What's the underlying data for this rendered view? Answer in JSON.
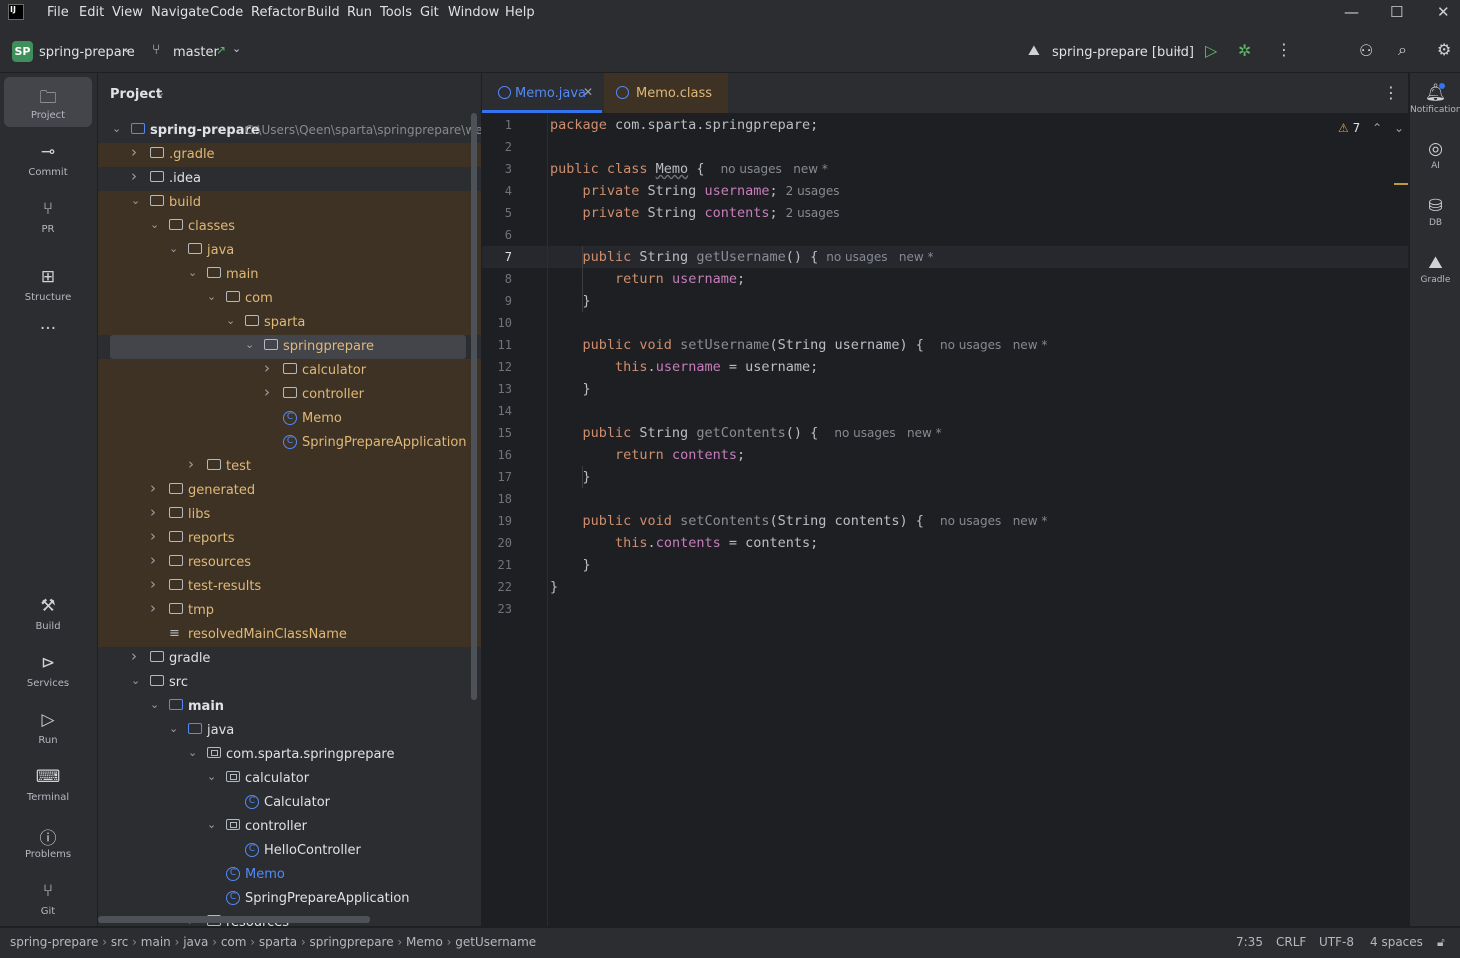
{
  "menu": {
    "items": [
      "File",
      "Edit",
      "View",
      "Navigate",
      "Code",
      "Refactor",
      "Build",
      "Run",
      "Tools",
      "Git",
      "Window",
      "Help"
    ]
  },
  "toolbar": {
    "project_badge": "SP",
    "project_name": "spring-prepare",
    "branch": "master",
    "run_config": "spring-prepare [build]"
  },
  "left_stripe": {
    "top": [
      {
        "label": "Project",
        "icon": "folder-icon"
      },
      {
        "label": "Commit",
        "icon": "commit-icon"
      },
      {
        "label": "PR",
        "icon": "pull-request-icon"
      },
      {
        "label": "Structure",
        "icon": "structure-icon"
      }
    ],
    "bottom": [
      {
        "label": "Build",
        "icon": "hammer-icon"
      },
      {
        "label": "Services",
        "icon": "services-icon"
      },
      {
        "label": "Run",
        "icon": "run-icon"
      },
      {
        "label": "Terminal",
        "icon": "terminal-icon"
      },
      {
        "label": "Problems",
        "icon": "problems-icon"
      },
      {
        "label": "Git",
        "icon": "git-icon"
      }
    ]
  },
  "project_panel": {
    "title": "Project",
    "tree": [
      {
        "label": "spring-prepare",
        "path": "C:\\Users\\Qeen\\sparta\\springprepare\\wee",
        "type": "module",
        "depth": 0,
        "expanded": true
      },
      {
        "label": ".gradle",
        "type": "folder",
        "depth": 1,
        "expanded": false,
        "excluded": true
      },
      {
        "label": ".idea",
        "type": "folder",
        "depth": 1,
        "expanded": false
      },
      {
        "label": "build",
        "type": "folder",
        "depth": 1,
        "expanded": true,
        "excluded": true
      },
      {
        "label": "classes",
        "type": "folder",
        "depth": 2,
        "expanded": true,
        "excluded": true
      },
      {
        "label": "java",
        "type": "folder",
        "depth": 3,
        "expanded": true,
        "excluded": true
      },
      {
        "label": "main",
        "type": "folder",
        "depth": 4,
        "expanded": true,
        "excluded": true
      },
      {
        "label": "com",
        "type": "folder",
        "depth": 5,
        "expanded": true,
        "excluded": true
      },
      {
        "label": "sparta",
        "type": "folder",
        "depth": 6,
        "expanded": true,
        "excluded": true
      },
      {
        "label": "springprepare",
        "type": "folder",
        "depth": 7,
        "expanded": true,
        "excluded": true,
        "selected": true
      },
      {
        "label": "calculator",
        "type": "folder",
        "depth": 8,
        "expanded": false,
        "excluded": true
      },
      {
        "label": "controller",
        "type": "folder",
        "depth": 8,
        "expanded": false,
        "excluded": true
      },
      {
        "label": "Memo",
        "type": "class",
        "depth": 8,
        "excluded": true
      },
      {
        "label": "SpringPrepareApplication",
        "type": "class",
        "depth": 8,
        "excluded": true
      },
      {
        "label": "test",
        "type": "folder",
        "depth": 4,
        "expanded": false,
        "excluded": true
      },
      {
        "label": "generated",
        "type": "folder",
        "depth": 2,
        "expanded": false,
        "excluded": true
      },
      {
        "label": "libs",
        "type": "folder",
        "depth": 2,
        "expanded": false,
        "excluded": true
      },
      {
        "label": "reports",
        "type": "folder",
        "depth": 2,
        "expanded": false,
        "excluded": true
      },
      {
        "label": "resources",
        "type": "folder",
        "depth": 2,
        "expanded": false,
        "excluded": true
      },
      {
        "label": "test-results",
        "type": "folder",
        "depth": 2,
        "expanded": false,
        "excluded": true
      },
      {
        "label": "tmp",
        "type": "folder",
        "depth": 2,
        "expanded": false,
        "excluded": true
      },
      {
        "label": "resolvedMainClassName",
        "type": "file",
        "depth": 2,
        "excluded": true
      },
      {
        "label": "gradle",
        "type": "folder",
        "depth": 1,
        "expanded": false
      },
      {
        "label": "src",
        "type": "folder",
        "depth": 1,
        "expanded": true
      },
      {
        "label": "main",
        "type": "srcfolder",
        "depth": 2,
        "expanded": true,
        "bold": true
      },
      {
        "label": "java",
        "type": "srcfolder",
        "depth": 3,
        "expanded": true
      },
      {
        "label": "com.sparta.springprepare",
        "type": "package",
        "depth": 4,
        "expanded": true
      },
      {
        "label": "calculator",
        "type": "package",
        "depth": 5,
        "expanded": true
      },
      {
        "label": "Calculator",
        "type": "class",
        "depth": 6
      },
      {
        "label": "controller",
        "type": "package",
        "depth": 5,
        "expanded": true
      },
      {
        "label": "HelloController",
        "type": "class",
        "depth": 6
      },
      {
        "label": "Memo",
        "type": "class",
        "depth": 5,
        "modified": true
      },
      {
        "label": "SpringPrepareApplication",
        "type": "class",
        "depth": 5
      },
      {
        "label": "resources",
        "type": "folder",
        "depth": 4,
        "expanded": false
      }
    ]
  },
  "editor": {
    "tabs": [
      {
        "label": "Memo.java",
        "active": true,
        "closable": true
      },
      {
        "label": "Memo.class",
        "active": false
      }
    ],
    "warnings_count": "7",
    "current_line": 7,
    "lines": [
      {
        "n": "1",
        "tokens": [
          [
            "kw",
            "package "
          ],
          [
            "txt",
            "com.sparta.springprepare;"
          ]
        ]
      },
      {
        "n": "2",
        "tokens": []
      },
      {
        "n": "3",
        "tokens": [
          [
            "kw",
            "public class "
          ],
          [
            "cls",
            "Memo"
          ],
          [
            "txt",
            " { "
          ]
        ],
        "hint": "no usages   new *"
      },
      {
        "n": "4",
        "tokens": [
          [
            "txt",
            "    "
          ],
          [
            "kw",
            "private "
          ],
          [
            "txt",
            "String "
          ],
          [
            "fld",
            "username"
          ],
          [
            "txt",
            ";"
          ]
        ],
        "hint": "2 usages"
      },
      {
        "n": "5",
        "tokens": [
          [
            "txt",
            "    "
          ],
          [
            "kw",
            "private "
          ],
          [
            "txt",
            "String "
          ],
          [
            "fld",
            "contents"
          ],
          [
            "txt",
            ";"
          ]
        ],
        "hint": "2 usages"
      },
      {
        "n": "6",
        "tokens": []
      },
      {
        "n": "7",
        "tokens": [
          [
            "txt",
            "    "
          ],
          [
            "kw",
            "public "
          ],
          [
            "txt",
            "String "
          ],
          [
            "mthd",
            "getUsername"
          ],
          [
            "txt",
            "() {"
          ]
        ],
        "hint": "no usages   new *"
      },
      {
        "n": "8",
        "tokens": [
          [
            "txt",
            "        "
          ],
          [
            "kw",
            "return "
          ],
          [
            "fld",
            "username"
          ],
          [
            "txt",
            ";"
          ]
        ]
      },
      {
        "n": "9",
        "tokens": [
          [
            "txt",
            "    }"
          ]
        ]
      },
      {
        "n": "10",
        "tokens": []
      },
      {
        "n": "11",
        "tokens": [
          [
            "txt",
            "    "
          ],
          [
            "kw",
            "public void "
          ],
          [
            "mthd",
            "setUsername"
          ],
          [
            "txt",
            "(String username) { "
          ]
        ],
        "hint": "no usages   new *"
      },
      {
        "n": "12",
        "tokens": [
          [
            "txt",
            "        "
          ],
          [
            "kw",
            "this"
          ],
          [
            "txt",
            "."
          ],
          [
            "fld",
            "username"
          ],
          [
            "txt",
            " = username;"
          ]
        ]
      },
      {
        "n": "13",
        "tokens": [
          [
            "txt",
            "    }"
          ]
        ]
      },
      {
        "n": "14",
        "tokens": []
      },
      {
        "n": "15",
        "tokens": [
          [
            "txt",
            "    "
          ],
          [
            "kw",
            "public "
          ],
          [
            "txt",
            "String "
          ],
          [
            "mthd",
            "getContents"
          ],
          [
            "txt",
            "() { "
          ]
        ],
        "hint": "no usages   new *"
      },
      {
        "n": "16",
        "tokens": [
          [
            "txt",
            "        "
          ],
          [
            "kw",
            "return "
          ],
          [
            "fld",
            "contents"
          ],
          [
            "txt",
            ";"
          ]
        ]
      },
      {
        "n": "17",
        "tokens": [
          [
            "txt",
            "    }"
          ]
        ]
      },
      {
        "n": "18",
        "tokens": []
      },
      {
        "n": "19",
        "tokens": [
          [
            "txt",
            "    "
          ],
          [
            "kw",
            "public void "
          ],
          [
            "mthd",
            "setContents"
          ],
          [
            "txt",
            "(String contents) { "
          ]
        ],
        "hint": "no usages   new *"
      },
      {
        "n": "20",
        "tokens": [
          [
            "txt",
            "        "
          ],
          [
            "kw",
            "this"
          ],
          [
            "txt",
            "."
          ],
          [
            "fld",
            "contents"
          ],
          [
            "txt",
            " = contents;"
          ]
        ]
      },
      {
        "n": "21",
        "tokens": [
          [
            "txt",
            "    }"
          ]
        ]
      },
      {
        "n": "22",
        "tokens": [
          [
            "txt",
            "}"
          ]
        ]
      },
      {
        "n": "23",
        "tokens": []
      }
    ]
  },
  "right_stripe": [
    {
      "label": "Notifications",
      "icon": "bell-icon"
    },
    {
      "label": "AI",
      "icon": "ai-icon"
    },
    {
      "label": "DB",
      "icon": "database-icon"
    },
    {
      "label": "Gradle",
      "icon": "gradle-icon"
    }
  ],
  "statusbar": {
    "breadcrumbs": [
      "spring-prepare",
      "src",
      "main",
      "java",
      "com",
      "sparta",
      "springprepare",
      "Memo",
      "getUsername"
    ],
    "position": "7:35",
    "line_sep": "CRLF",
    "encoding": "UTF-8",
    "indent": "4 spaces"
  },
  "colors": {
    "accent": "#3574f0",
    "excluded_bg": "#3d3223",
    "excluded_text": "#e0b878",
    "keyword": "#cf8e6d",
    "field": "#c77dbb",
    "method": "#56a8f5",
    "run_green": "#5fb865",
    "warning": "#e0a040"
  }
}
